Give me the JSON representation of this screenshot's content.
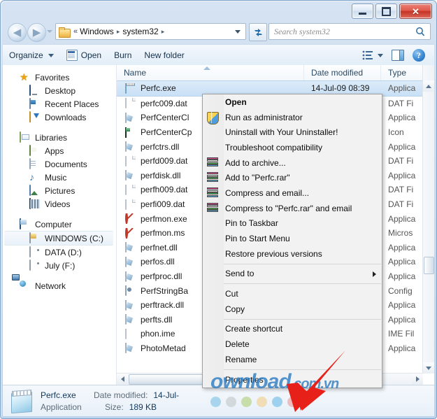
{
  "window": {
    "buttons": {
      "minimize": "—",
      "maximize": "□",
      "close": "✕"
    }
  },
  "nav": {
    "back_icon": "back-arrow-icon",
    "forward_icon": "forward-arrow-icon",
    "history_dropdown": "history-dropdown-icon",
    "breadcrumb": {
      "double_chevron": "«",
      "items": [
        "Windows",
        "system32"
      ],
      "separator": "▸"
    },
    "address_dropdown": "address-dropdown-icon",
    "refresh_icon": "refresh-icon",
    "search": {
      "placeholder": "Search system32",
      "icon": "search-icon"
    }
  },
  "toolbar": {
    "organize": "Organize",
    "open": "Open",
    "burn": "Burn",
    "new_folder": "New folder",
    "view_icon": "view-list-icon",
    "preview_pane_icon": "preview-pane-icon",
    "help_icon": "help-icon",
    "help_glyph": "?"
  },
  "sidebar": {
    "groups": [
      {
        "header": {
          "label": "Favorites",
          "icon": "star-icon"
        },
        "items": [
          {
            "label": "Desktop",
            "icon": "desktop-monitor-icon"
          },
          {
            "label": "Recent Places",
            "icon": "recent-places-icon"
          },
          {
            "label": "Downloads",
            "icon": "downloads-icon"
          }
        ]
      },
      {
        "header": {
          "label": "Libraries",
          "icon": "libraries-icon"
        },
        "items": [
          {
            "label": "Apps",
            "icon": "apps-icon"
          },
          {
            "label": "Documents",
            "icon": "documents-icon"
          },
          {
            "label": "Music",
            "icon": "music-note-icon"
          },
          {
            "label": "Pictures",
            "icon": "pictures-icon"
          },
          {
            "label": "Videos",
            "icon": "videos-icon"
          }
        ]
      },
      {
        "header": {
          "label": "Computer",
          "icon": "computer-icon"
        },
        "items": [
          {
            "label": "WINDOWS (C:)",
            "icon": "windows-drive-icon",
            "selected": true
          },
          {
            "label": "DATA (D:)",
            "icon": "drive-icon"
          },
          {
            "label": "July (F:)",
            "icon": "drive-icon"
          }
        ]
      },
      {
        "header": {
          "label": "Network",
          "icon": "network-icon"
        },
        "items": []
      }
    ]
  },
  "filelist": {
    "columns": [
      {
        "label": "Name",
        "key": "name"
      },
      {
        "label": "Date modified",
        "key": "date"
      },
      {
        "label": "Type",
        "key": "type"
      }
    ],
    "sort_column": "Name",
    "sort_direction": "ascending",
    "rows": [
      {
        "name": "Perfc.exe",
        "date": "14-Jul-09 08:39",
        "type": "Applica",
        "icon": "exe-icon",
        "selected": true
      },
      {
        "name": "perfc009.dat",
        "date": "",
        "type": "DAT Fi",
        "icon": "dat-icon"
      },
      {
        "name": "PerfCenterCl",
        "date": "",
        "type": "Applica",
        "icon": "dll-icon"
      },
      {
        "name": "PerfCenterCp",
        "date": "",
        "type": "Icon",
        "icon": "icon-file-icon"
      },
      {
        "name": "perfctrs.dll",
        "date": "",
        "type": "Applica",
        "icon": "dll-icon"
      },
      {
        "name": "perfd009.dat",
        "date": "",
        "type": "DAT Fi",
        "icon": "dat-icon"
      },
      {
        "name": "perfdisk.dll",
        "date": "",
        "type": "Applica",
        "icon": "dll-icon"
      },
      {
        "name": "perfh009.dat",
        "date": "",
        "type": "DAT Fi",
        "icon": "dat-icon"
      },
      {
        "name": "perfi009.dat",
        "date": "",
        "type": "DAT Fi",
        "icon": "dat-icon"
      },
      {
        "name": "perfmon.exe",
        "date": "",
        "type": "Applica",
        "icon": "msc-icon"
      },
      {
        "name": "perfmon.ms",
        "date": "",
        "type": "Micros",
        "icon": "msc-icon"
      },
      {
        "name": "perfnet.dll",
        "date": "",
        "type": "Applica",
        "icon": "dll-icon"
      },
      {
        "name": "perfos.dll",
        "date": "",
        "type": "Applica",
        "icon": "dll-icon"
      },
      {
        "name": "perfproc.dll",
        "date": "",
        "type": "Applica",
        "icon": "dll-icon"
      },
      {
        "name": "PerfStringBa",
        "date": "",
        "type": "Config",
        "icon": "cfg-icon"
      },
      {
        "name": "perftrack.dll",
        "date": "",
        "type": "Applica",
        "icon": "dll-icon"
      },
      {
        "name": "perfts.dll",
        "date": "",
        "type": "Applica",
        "icon": "dll-icon"
      },
      {
        "name": "phon.ime",
        "date": "",
        "type": "IME Fil",
        "icon": "ime-icon"
      },
      {
        "name": "PhotoMetad",
        "date": "",
        "type": "Applica",
        "icon": "dll-icon"
      }
    ]
  },
  "context_menu": {
    "items": [
      {
        "label": "Open",
        "bold": true,
        "icon": null
      },
      {
        "label": "Run as administrator",
        "icon": "uac-shield-icon"
      },
      {
        "label": "Uninstall with Your Uninstaller!",
        "icon": null
      },
      {
        "label": "Troubleshoot compatibility",
        "icon": null
      },
      {
        "label": "Add to archive...",
        "icon": "winrar-icon"
      },
      {
        "label": "Add to \"Perfc.rar\"",
        "icon": "winrar-icon"
      },
      {
        "label": "Compress and email...",
        "icon": "winrar-icon"
      },
      {
        "label": "Compress to \"Perfc.rar\" and email",
        "icon": "winrar-icon"
      },
      {
        "label": "Pin to Taskbar",
        "icon": null
      },
      {
        "label": "Pin to Start Menu",
        "icon": null
      },
      {
        "label": "Restore previous versions",
        "icon": null
      },
      {
        "separator": true
      },
      {
        "label": "Send to",
        "icon": null,
        "submenu": true
      },
      {
        "separator": true
      },
      {
        "label": "Cut",
        "icon": null
      },
      {
        "label": "Copy",
        "icon": null
      },
      {
        "separator": true
      },
      {
        "label": "Create shortcut",
        "icon": null
      },
      {
        "label": "Delete",
        "icon": null
      },
      {
        "label": "Rename",
        "icon": null
      },
      {
        "separator": true
      },
      {
        "label": "Properties",
        "icon": null
      }
    ]
  },
  "details_pane": {
    "file_name": "Perfc.exe",
    "file_kind": "Application",
    "date_label": "Date modified:",
    "date_value": "14-Jul-",
    "size_label": "Size:",
    "size_value": "189 KB",
    "icon": "notepad-file-icon"
  },
  "annotation": {
    "arrow": "red-arrow-pointing-to-properties",
    "arrow_color": "#e8201a"
  },
  "watermark": {
    "main": "ownload",
    "suffix": ".com.vn",
    "dot_colors": [
      "#8ec9e8",
      "#c9cdd0",
      "#b9d48a",
      "#f1d39a",
      "#7fc4e8",
      "#efa9a6"
    ]
  }
}
